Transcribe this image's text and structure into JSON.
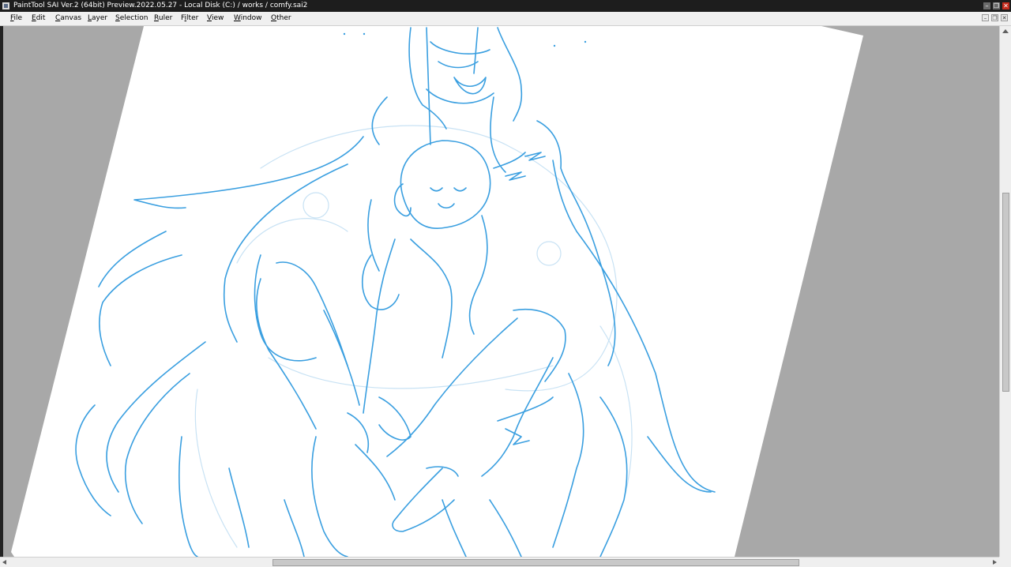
{
  "window": {
    "title": "PaintTool SAI Ver.2 (64bit) Preview.2022.05.27 - Local Disk (C:) / works / comfy.sai2",
    "minimize_glyph": "–",
    "maximize_glyph": "❐",
    "close_glyph": "✕"
  },
  "menu": [
    {
      "label": "File",
      "accel": "F",
      "rest": "ile"
    },
    {
      "label": "Edit",
      "accel": "E",
      "rest": "dit"
    },
    {
      "label": "Canvas",
      "accel": "C",
      "rest": "anvas"
    },
    {
      "label": "Layer",
      "accel": "L",
      "rest": "ayer"
    },
    {
      "label": "Selection",
      "accel": "S",
      "rest": "election"
    },
    {
      "label": "Ruler",
      "accel": "R",
      "rest": "uler"
    },
    {
      "label": "Filter",
      "pre": "F",
      "accel": "i",
      "rest": "lter"
    },
    {
      "label": "View",
      "accel": "V",
      "rest": "iew"
    },
    {
      "label": "Window",
      "accel": "W",
      "rest": "indow"
    },
    {
      "label": "Other",
      "accel": "O",
      "rest": "ther"
    }
  ],
  "document_controls": {
    "minimize_glyph": "–",
    "restore_glyph": "❐",
    "close_glyph": "✕"
  },
  "canvas": {
    "document": "comfy.sai2",
    "paper_color": "#ffffff",
    "workspace_color": "#a8a8a8",
    "sketch_color": "#3a9fe0",
    "faint_sketch_color": "#c8e2f4",
    "icon": "rotated-canvas-sketch"
  },
  "colors": {
    "titlebar": "#1d1d1d",
    "close": "#c42b1c",
    "menubar": "#f0f0f0"
  }
}
